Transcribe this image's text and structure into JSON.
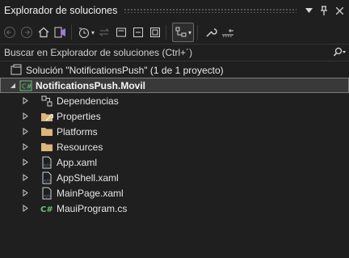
{
  "window": {
    "title": "Explorador de soluciones"
  },
  "title_buttons": [
    {
      "name": "dropdown-button",
      "glyph": "▾"
    },
    {
      "name": "pin-button",
      "glyph": "📌"
    },
    {
      "name": "close-button",
      "glyph": "✕"
    }
  ],
  "search": {
    "placeholder": "Buscar en Explorador de soluciones (Ctrl+´)"
  },
  "solution": {
    "label": "Solución \"NotificationsPush\"  (1 de 1 proyecto)"
  },
  "project": {
    "label": "NotificationsPush.Movil"
  },
  "items": [
    {
      "label": "Dependencias",
      "icon": "dependencies-icon"
    },
    {
      "label": "Properties",
      "icon": "properties-icon"
    },
    {
      "label": "Platforms",
      "icon": "folder-icon"
    },
    {
      "label": "Resources",
      "icon": "folder-icon"
    },
    {
      "label": "App.xaml",
      "icon": "xaml-file-icon"
    },
    {
      "label": "AppShell.xaml",
      "icon": "xaml-file-icon"
    },
    {
      "label": "MainPage.xaml",
      "icon": "xaml-file-icon"
    },
    {
      "label": "MauiProgram.cs",
      "icon": "csharp-file-icon"
    }
  ],
  "colors": {
    "background": "#1f1f1f",
    "selected_row": "#393939",
    "folder": "#dcb67a",
    "csharp": "#68c07a",
    "accent_blue": "#569cd6"
  }
}
